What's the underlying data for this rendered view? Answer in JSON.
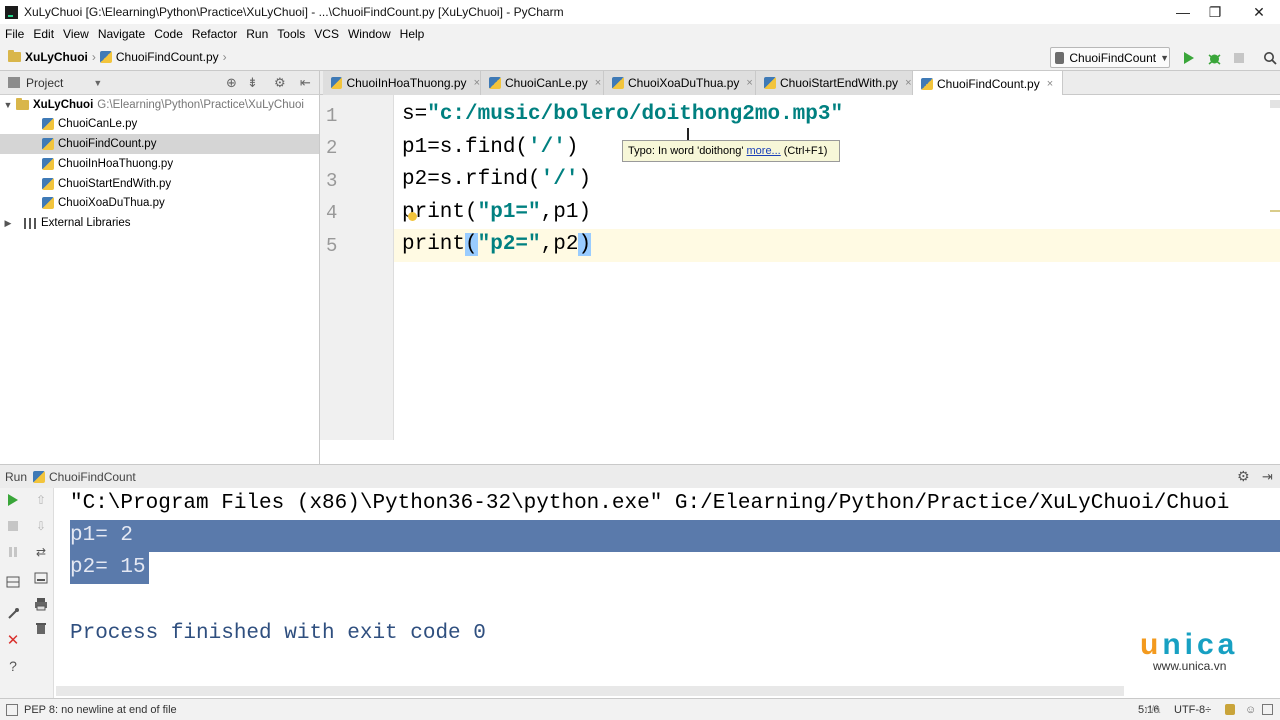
{
  "window": {
    "title": "XuLyChuoi [G:\\Elearning\\Python\\Practice\\XuLyChuoi] - ...\\ChuoiFindCount.py [XuLyChuoi] - PyCharm",
    "minimize": "—",
    "restore": "❐",
    "close": "✕"
  },
  "menu": [
    "File",
    "Edit",
    "View",
    "Navigate",
    "Code",
    "Refactor",
    "Run",
    "Tools",
    "VCS",
    "Window",
    "Help"
  ],
  "breadcrumb": {
    "project": "XuLyChuoi",
    "file": "ChuoiFindCount.py"
  },
  "run_config": {
    "name": "ChuoiFindCount"
  },
  "project_panel": {
    "header": "Project",
    "root": "XuLyChuoi",
    "root_path": "G:\\Elearning\\Python\\Practice\\XuLyChuoi",
    "files": [
      "ChuoiCanLe.py",
      "ChuoiFindCount.py",
      "ChuoiInHoaThuong.py",
      "ChuoiStartEndWith.py",
      "ChuoiXoaDuThua.py"
    ],
    "external": "External Libraries"
  },
  "tabs": [
    "ChuoiInHoaThuong.py",
    "ChuoiCanLe.py",
    "ChuoiXoaDuThua.py",
    "ChuoiStartEndWith.py",
    "ChuoiFindCount.py"
  ],
  "tab_close": "×",
  "editor": {
    "line_numbers": [
      "1",
      "2",
      "3",
      "4",
      "5"
    ],
    "line1_a": "s=",
    "line1_str": "\"c:/music/bolero/doithong2mo.mp3\"",
    "line2_a": "p1=s.find(",
    "line2_str": "'/'",
    "line2_b": ")",
    "line3_a": "p2=s.rfind(",
    "line3_str": "'/'",
    "line3_b": ")",
    "line4_a": "print(",
    "line4_str": "\"p1=\"",
    "line4_b": ",p1)",
    "line5_a": "print",
    "line5_p1": "(",
    "line5_str": "\"p2=\"",
    "line5_b": ",p2",
    "line5_p2": ")"
  },
  "tooltip": {
    "prefix": "Typo: In word 'doithong'",
    "link": "more...",
    "shortcut": "(Ctrl+F1)"
  },
  "run_panel": {
    "label": "Run",
    "config": "ChuoiFindCount"
  },
  "console": {
    "command": "\"C:\\Program Files (x86)\\Python36-32\\python.exe\" G:/Elearning/Python/Practice/XuLyChuoi/Chuoi",
    "out1": "p1= 2",
    "out2": "p2= 15",
    "finished": "Process finished with exit code 0"
  },
  "status": {
    "message": "PEP 8: no newline at end of file",
    "position": "5:16",
    "na": "n/a",
    "encoding": "UTF-8÷"
  },
  "watermark": {
    "brand_u": "u",
    "brand_rest": "nica",
    "site": "www.unica.vn"
  },
  "colors": {
    "string": "#008080",
    "selection": "#5a7aab",
    "run_green": "#3aa63a"
  }
}
